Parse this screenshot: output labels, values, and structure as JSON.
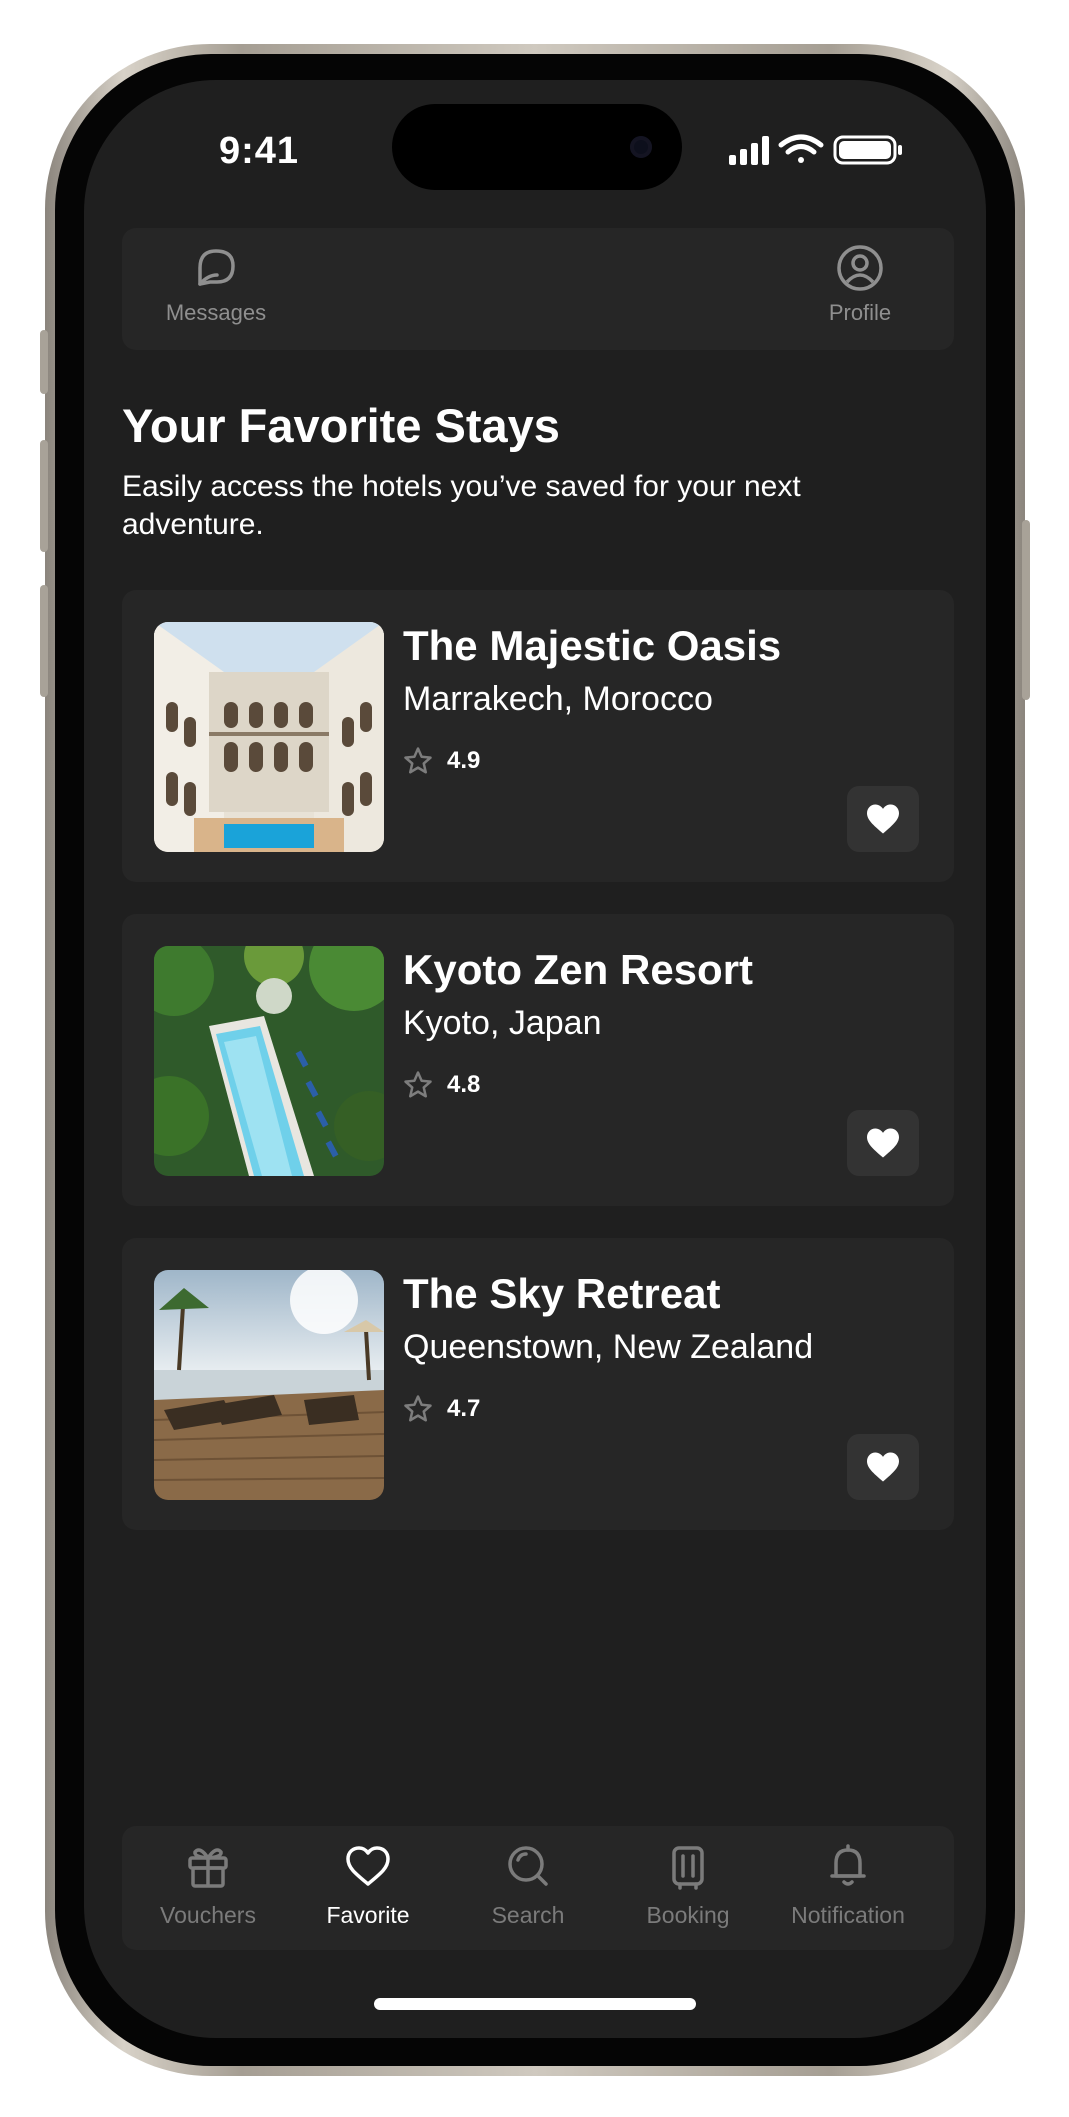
{
  "status_bar": {
    "time": "9:41"
  },
  "top_nav": {
    "messages_label": "Messages",
    "profile_label": "Profile"
  },
  "header": {
    "title": "Your Favorite Stays",
    "subtitle": "Easily access the hotels you’ve saved for your next adventure."
  },
  "favorites": [
    {
      "name": "The Majestic Oasis",
      "location": "Marrakech, Morocco",
      "rating": "4.9",
      "image": "riad-courtyard-pool"
    },
    {
      "name": "Kyoto Zen Resort",
      "location": "Kyoto, Japan",
      "rating": "4.8",
      "image": "tropical-pool-aerial"
    },
    {
      "name": "The Sky Retreat",
      "location": "Queenstown, New Zealand",
      "rating": "4.7",
      "image": "ocean-deck-loungers"
    }
  ],
  "tab_bar": {
    "active": "Favorite",
    "tabs": [
      {
        "label": "Vouchers",
        "icon": "gift-icon"
      },
      {
        "label": "Favorite",
        "icon": "heart-icon"
      },
      {
        "label": "Search",
        "icon": "search-icon"
      },
      {
        "label": "Booking",
        "icon": "luggage-icon"
      },
      {
        "label": "Notification",
        "icon": "bell-icon"
      }
    ]
  },
  "colors": {
    "screen_bg": "#1f1f1f",
    "card_bg": "#262626",
    "text_primary": "#ffffff",
    "text_muted": "#8f8f8f"
  }
}
